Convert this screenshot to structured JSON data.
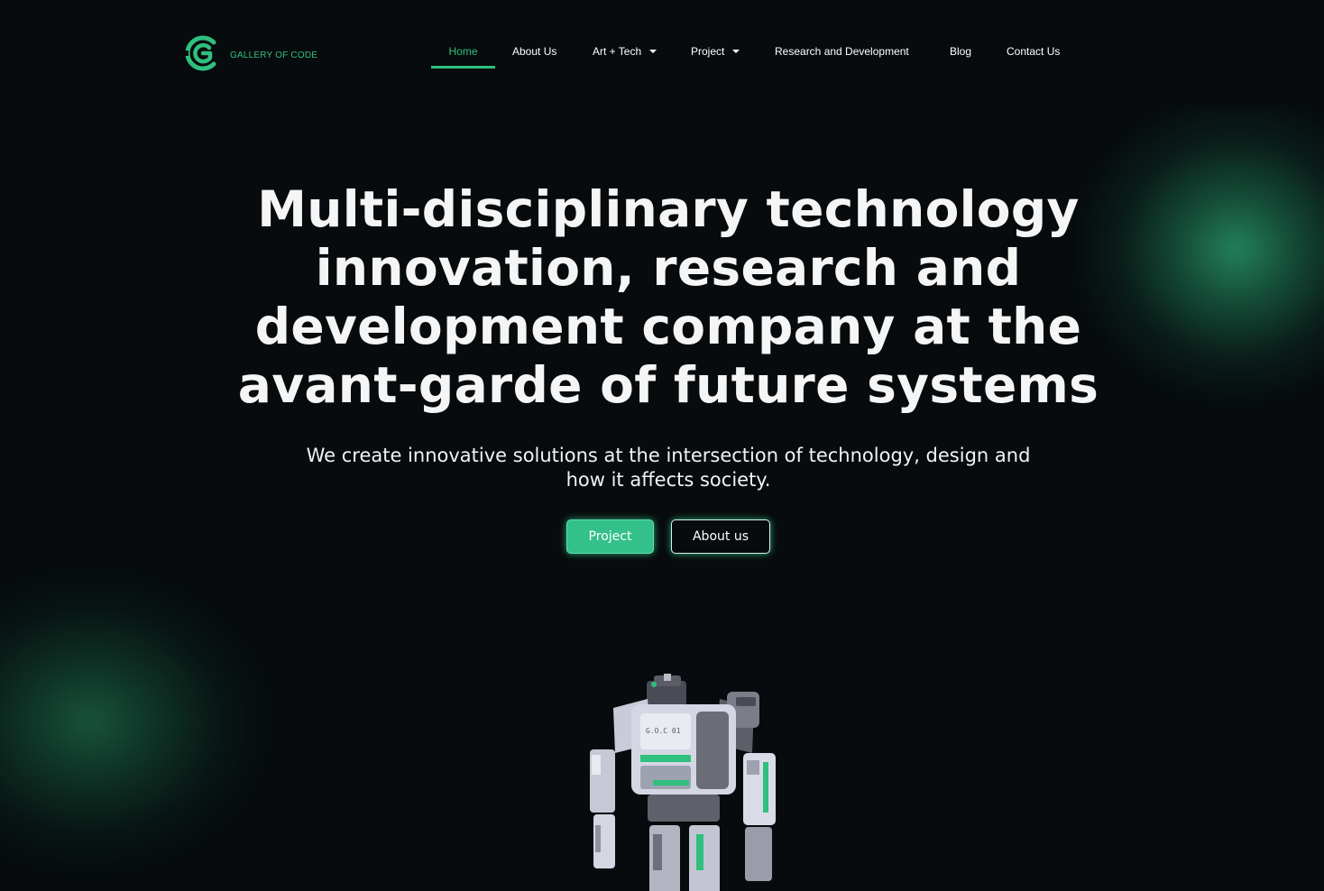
{
  "brand": {
    "name": "GALLERY OF CODE",
    "accent_color": "#2fc07e",
    "logo_icon": "gallery-of-code-logo-icon"
  },
  "nav": {
    "items": [
      {
        "label": "Home",
        "active": true
      },
      {
        "label": "About Us"
      },
      {
        "label": "Art + Tech",
        "dropdown": true
      },
      {
        "label": "Project",
        "dropdown": true
      },
      {
        "label": "Research and Development"
      },
      {
        "label": "Blog"
      },
      {
        "label": "Contact Us"
      }
    ]
  },
  "hero": {
    "title": "Multi-disciplinary technology innovation, research and development company at the avant-garde of future systems",
    "subtitle": "We create innovative solutions at the intersection of technology, design and how it affects society.",
    "primary_button": "Project",
    "secondary_button": "About us",
    "robot_label": "G.O.C 01"
  },
  "colors": {
    "background": "#070b0d",
    "accent": "#2fc07e",
    "button_primary": "#33c08a",
    "glow": "#25875f"
  }
}
